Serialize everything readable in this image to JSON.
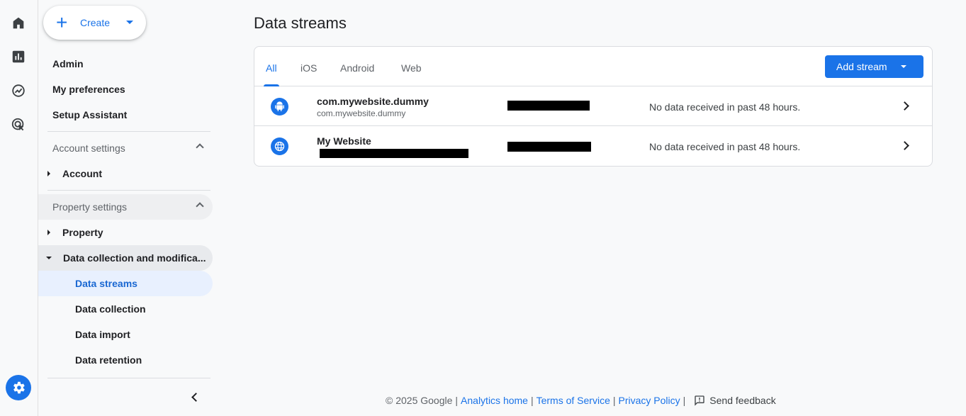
{
  "nav": {
    "create_label": "Create",
    "top_items": [
      "Admin",
      "My preferences",
      "Setup Assistant"
    ],
    "account_settings": {
      "header": "Account settings",
      "items": [
        "Account"
      ]
    },
    "property_settings": {
      "header": "Property settings",
      "property": "Property",
      "data_collection": "Data collection and modifica...",
      "sub_items": [
        "Data streams",
        "Data collection",
        "Data import",
        "Data retention"
      ]
    }
  },
  "main": {
    "title": "Data streams",
    "tabs": [
      "All",
      "iOS",
      "Android",
      "Web"
    ],
    "active_tab": "All",
    "add_stream_label": "Add stream",
    "streams": [
      {
        "icon": "android-icon",
        "name": "com.mywebsite.dummy",
        "sub": "com.mywebsite.dummy",
        "status": "No data received in past 48 hours."
      },
      {
        "icon": "web-globe-icon",
        "name": "My Website",
        "sub": "",
        "status": "No data received in past 48 hours."
      }
    ]
  },
  "footer": {
    "copyright": "© 2025 Google",
    "links": [
      "Analytics home",
      "Terms of Service",
      "Privacy Policy"
    ],
    "feedback": "Send feedback"
  },
  "colors": {
    "accent": "#1a73e8",
    "active_bg": "#e8f0fe"
  }
}
